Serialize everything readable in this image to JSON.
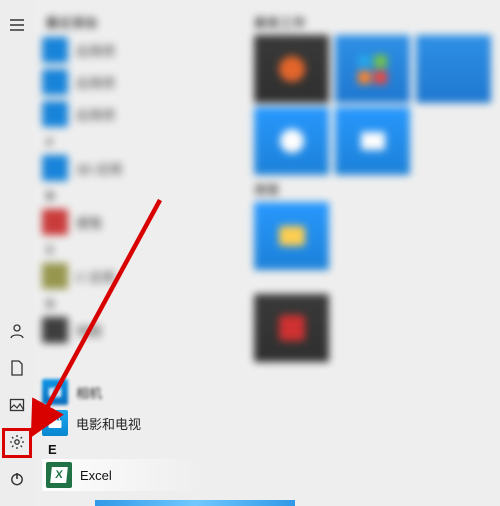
{
  "rail": {
    "hamburger": "menu-icon",
    "user": "user-icon",
    "documents": "documents-icon",
    "pictures": "pictures-icon",
    "settings": "settings-icon",
    "power": "power-icon"
  },
  "apps": {
    "header_recent": "最近添加",
    "recent": [
      {
        "label": "应用项",
        "color": "c-blue"
      },
      {
        "label": "应用项",
        "color": "c-blue"
      },
      {
        "label": "应用项",
        "color": "c-blue"
      }
    ],
    "letter_hash": "#",
    "hash_items": [
      {
        "label": "3D 应用",
        "color": "c-blue"
      }
    ],
    "letter_b": "B",
    "b_items": [
      {
        "label": "便笺",
        "color": "c-red"
      }
    ],
    "letter_c": "C",
    "c_items": [
      {
        "label": "C 应用",
        "color": "c-olive"
      }
    ],
    "letter_d": "D",
    "d_items": [
      {
        "label": "地图",
        "color": "c-dark"
      },
      {
        "label": "相机",
        "color": "c-blue",
        "sharp": true,
        "kind": "camera"
      },
      {
        "label": "电影和电视",
        "color": "c-blue",
        "sharp": true,
        "kind": "movies"
      }
    ],
    "letter_e": "E",
    "e_items": [
      {
        "label": "Excel",
        "kind": "excel"
      }
    ]
  },
  "tiles": {
    "header_productivity": "高效工作",
    "header_explore": "浏览"
  },
  "annotation": {
    "arrow_target": "settings-icon",
    "highlight": "settings-button"
  }
}
